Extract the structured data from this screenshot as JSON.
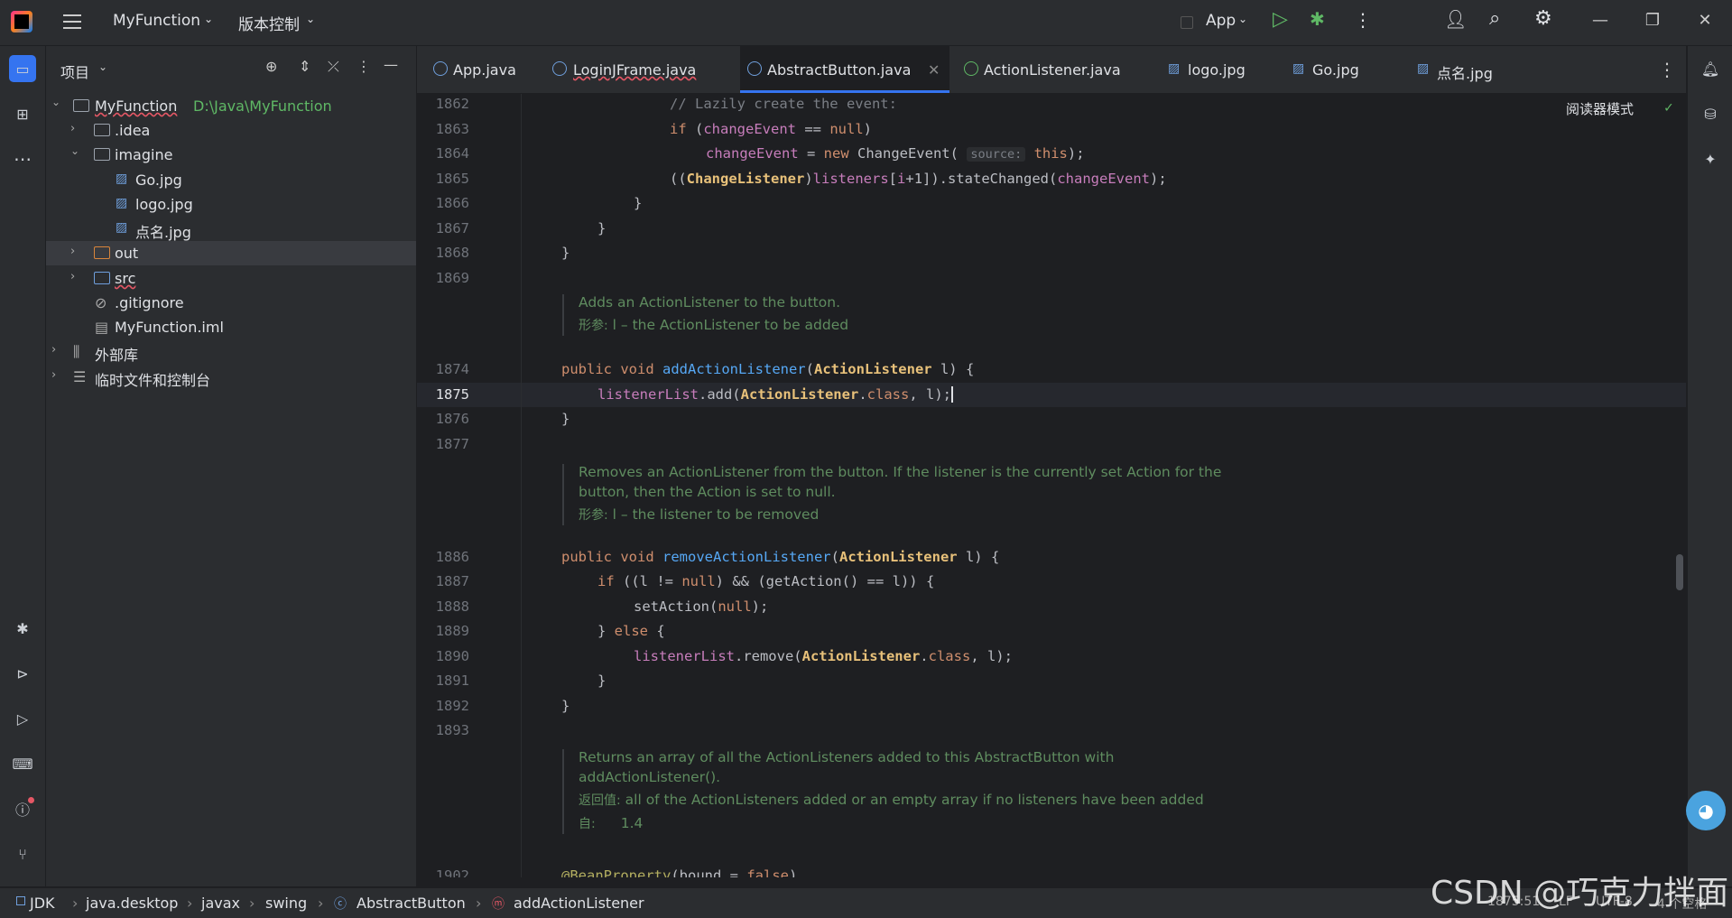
{
  "title_bar": {
    "project_name": "MyFunction",
    "vcs_menu": "版本控制",
    "run_config": "App"
  },
  "project_panel": {
    "title": "项目",
    "tree": [
      {
        "label": "MyFunction",
        "path": "D:\\Java\\MyFunction"
      },
      {
        "label": ".idea"
      },
      {
        "label": "imagine"
      },
      {
        "label": "Go.jpg"
      },
      {
        "label": "logo.jpg"
      },
      {
        "label": "点名.jpg"
      },
      {
        "label": "out"
      },
      {
        "label": "src"
      },
      {
        "label": ".gitignore"
      },
      {
        "label": "MyFunction.iml"
      },
      {
        "label": "外部库"
      },
      {
        "label": "临时文件和控制台"
      }
    ]
  },
  "tabs": [
    {
      "label": "App.java"
    },
    {
      "label": "LoginJFrame.java"
    },
    {
      "label": "AbstractButton.java"
    },
    {
      "label": "ActionListener.java"
    },
    {
      "label": "logo.jpg"
    },
    {
      "label": "Go.jpg"
    },
    {
      "label": "点名.jpg"
    }
  ],
  "editor": {
    "reader_mode": "阅读器模式",
    "line_numbers": [
      "1862",
      "1863",
      "1864",
      "1865",
      "1866",
      "1867",
      "1868",
      "1869",
      "1874",
      "1875",
      "1876",
      "1877",
      "1886",
      "1887",
      "1888",
      "1889",
      "1890",
      "1891",
      "1892",
      "1893",
      "1902"
    ],
    "inlay_hint": "source:",
    "docs": {
      "add": {
        "line1": "Adds an ActionListener to the button.",
        "param_label": "形参:",
        "param": "l – the ActionListener to be added"
      },
      "remove": {
        "line1": "Removes an ActionListener from the button. If the listener is the currently set Action for the",
        "line2": "button, then the Action is set to null.",
        "param_label": "形参:",
        "param": "l – the listener to be removed"
      },
      "get": {
        "line1": "Returns an array of all the ActionListeners added to this AbstractButton with",
        "line2": "addActionListener().",
        "return_label": "返回值:",
        "return": "all of the ActionListeners added or an empty array if no listeners have been added",
        "since_label": "自:",
        "since": "1.4"
      }
    }
  },
  "status_bar": {
    "breadcrumb": [
      "JDK",
      "java.desktop",
      "javax",
      "swing",
      "AbstractButton",
      "addActionListener"
    ],
    "position": "1875:51",
    "line_sep": "LF",
    "encoding": "UTF-8",
    "indent": "4 个空格"
  },
  "watermark": "CSDN @巧克力拌面",
  "colors": {
    "accent": "#3574f0",
    "background": "#1e1f22",
    "panel": "#2b2d30"
  }
}
